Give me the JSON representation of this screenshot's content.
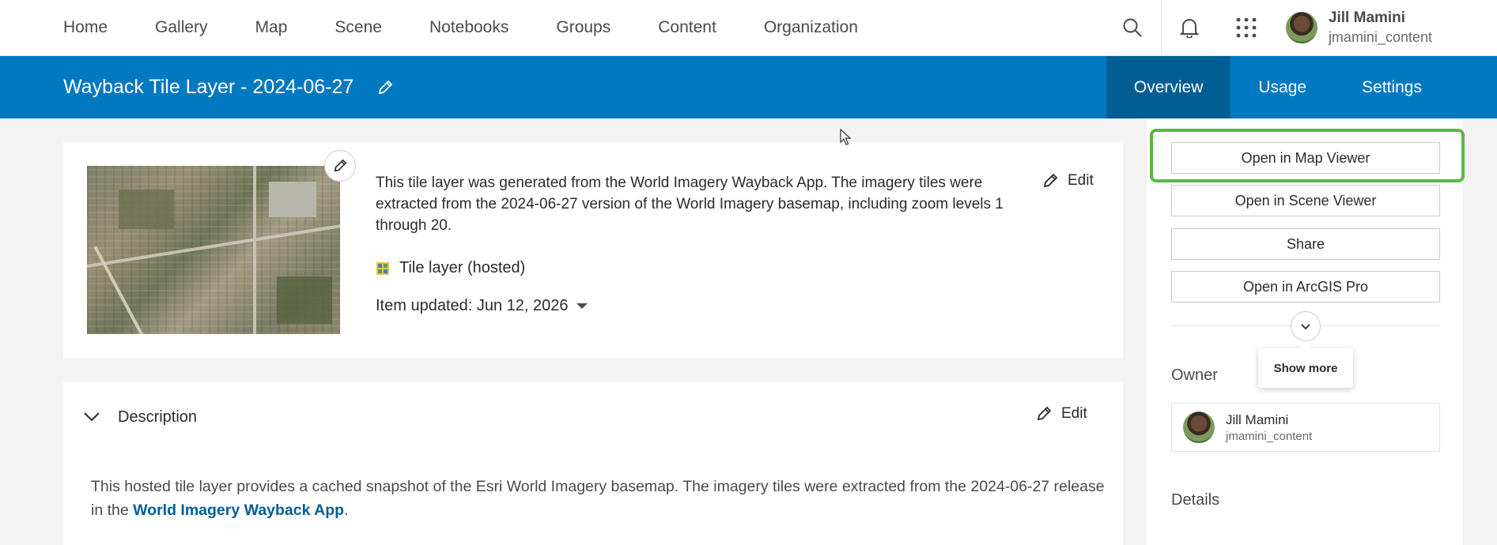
{
  "nav": {
    "links": [
      "Home",
      "Gallery",
      "Map",
      "Scene",
      "Notebooks",
      "Groups",
      "Content",
      "Organization"
    ]
  },
  "user": {
    "name": "Jill Mamini",
    "login": "jmamini_content"
  },
  "item": {
    "title": "Wayback Tile Layer - 2024-06-27",
    "tabs": [
      "Overview",
      "Usage",
      "Settings"
    ],
    "active_tab": "Overview"
  },
  "summary": {
    "description": "This tile layer was generated from the World Imagery Wayback App. The imagery tiles were extracted from the 2024-06-27 version of the World Imagery basemap, including zoom levels 1 through 20.",
    "type": "Tile layer (hosted)",
    "updated": "Item updated: Jun 12, 2026",
    "edit_label": "Edit"
  },
  "description_section": {
    "title": "Description",
    "edit_label": "Edit",
    "body_text": "This hosted tile layer provides a cached snapshot of the Esri World Imagery basemap. The imagery tiles were extracted from the 2024-06-27 release in the ",
    "link_text": "World Imagery Wayback App",
    "body_end": "."
  },
  "sidebar": {
    "buttons": [
      "Open in Map Viewer",
      "Open in Scene Viewer",
      "Share",
      "Open in ArcGIS Pro"
    ],
    "show_more_tooltip": "Show more",
    "owner_heading": "Owner",
    "owner_name": "Jill Mamini",
    "owner_login": "jmamini_content",
    "details_heading": "Details"
  },
  "colors": {
    "header_blue": "#0079c1",
    "active_tab": "#005e95",
    "highlight_green": "#5bb746",
    "link": "#005e95"
  }
}
